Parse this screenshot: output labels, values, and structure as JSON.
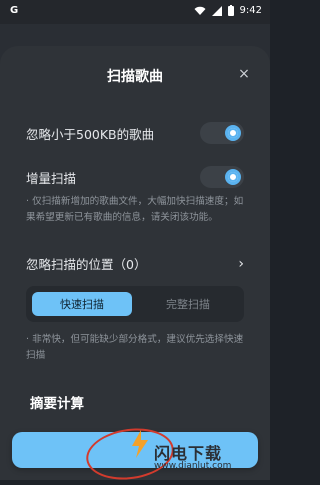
{
  "status": {
    "left_text": "G",
    "time": "9:42"
  },
  "sheet": {
    "title": "扫描歌曲",
    "close_symbol": "×"
  },
  "settings": {
    "ignore_small": {
      "label": "忽略小于500KB的歌曲",
      "enabled": true
    },
    "incremental": {
      "label": "增量扫描",
      "enabled": true,
      "hint": "· 仅扫描新增加的歌曲文件，大幅加快扫描速度；如果希望更新已有歌曲的信息，请关闭该功能。"
    },
    "ignore_locations": {
      "label": "忽略扫描的位置（0）",
      "chevron": "›"
    },
    "scan_mode": {
      "options": [
        "快速扫描",
        "完整扫描"
      ],
      "selected": "快速扫描",
      "hint": "· 非常快，但可能缺少部分格式，建议优先选择快速扫描"
    }
  },
  "section": {
    "title": "摘要计算"
  },
  "watermark": {
    "title": "闪电下载",
    "sub": "www.dianlut.com"
  },
  "colors": {
    "accent": "#6ec2f7",
    "sheet": "#2f3338",
    "background": "#1e2228"
  }
}
